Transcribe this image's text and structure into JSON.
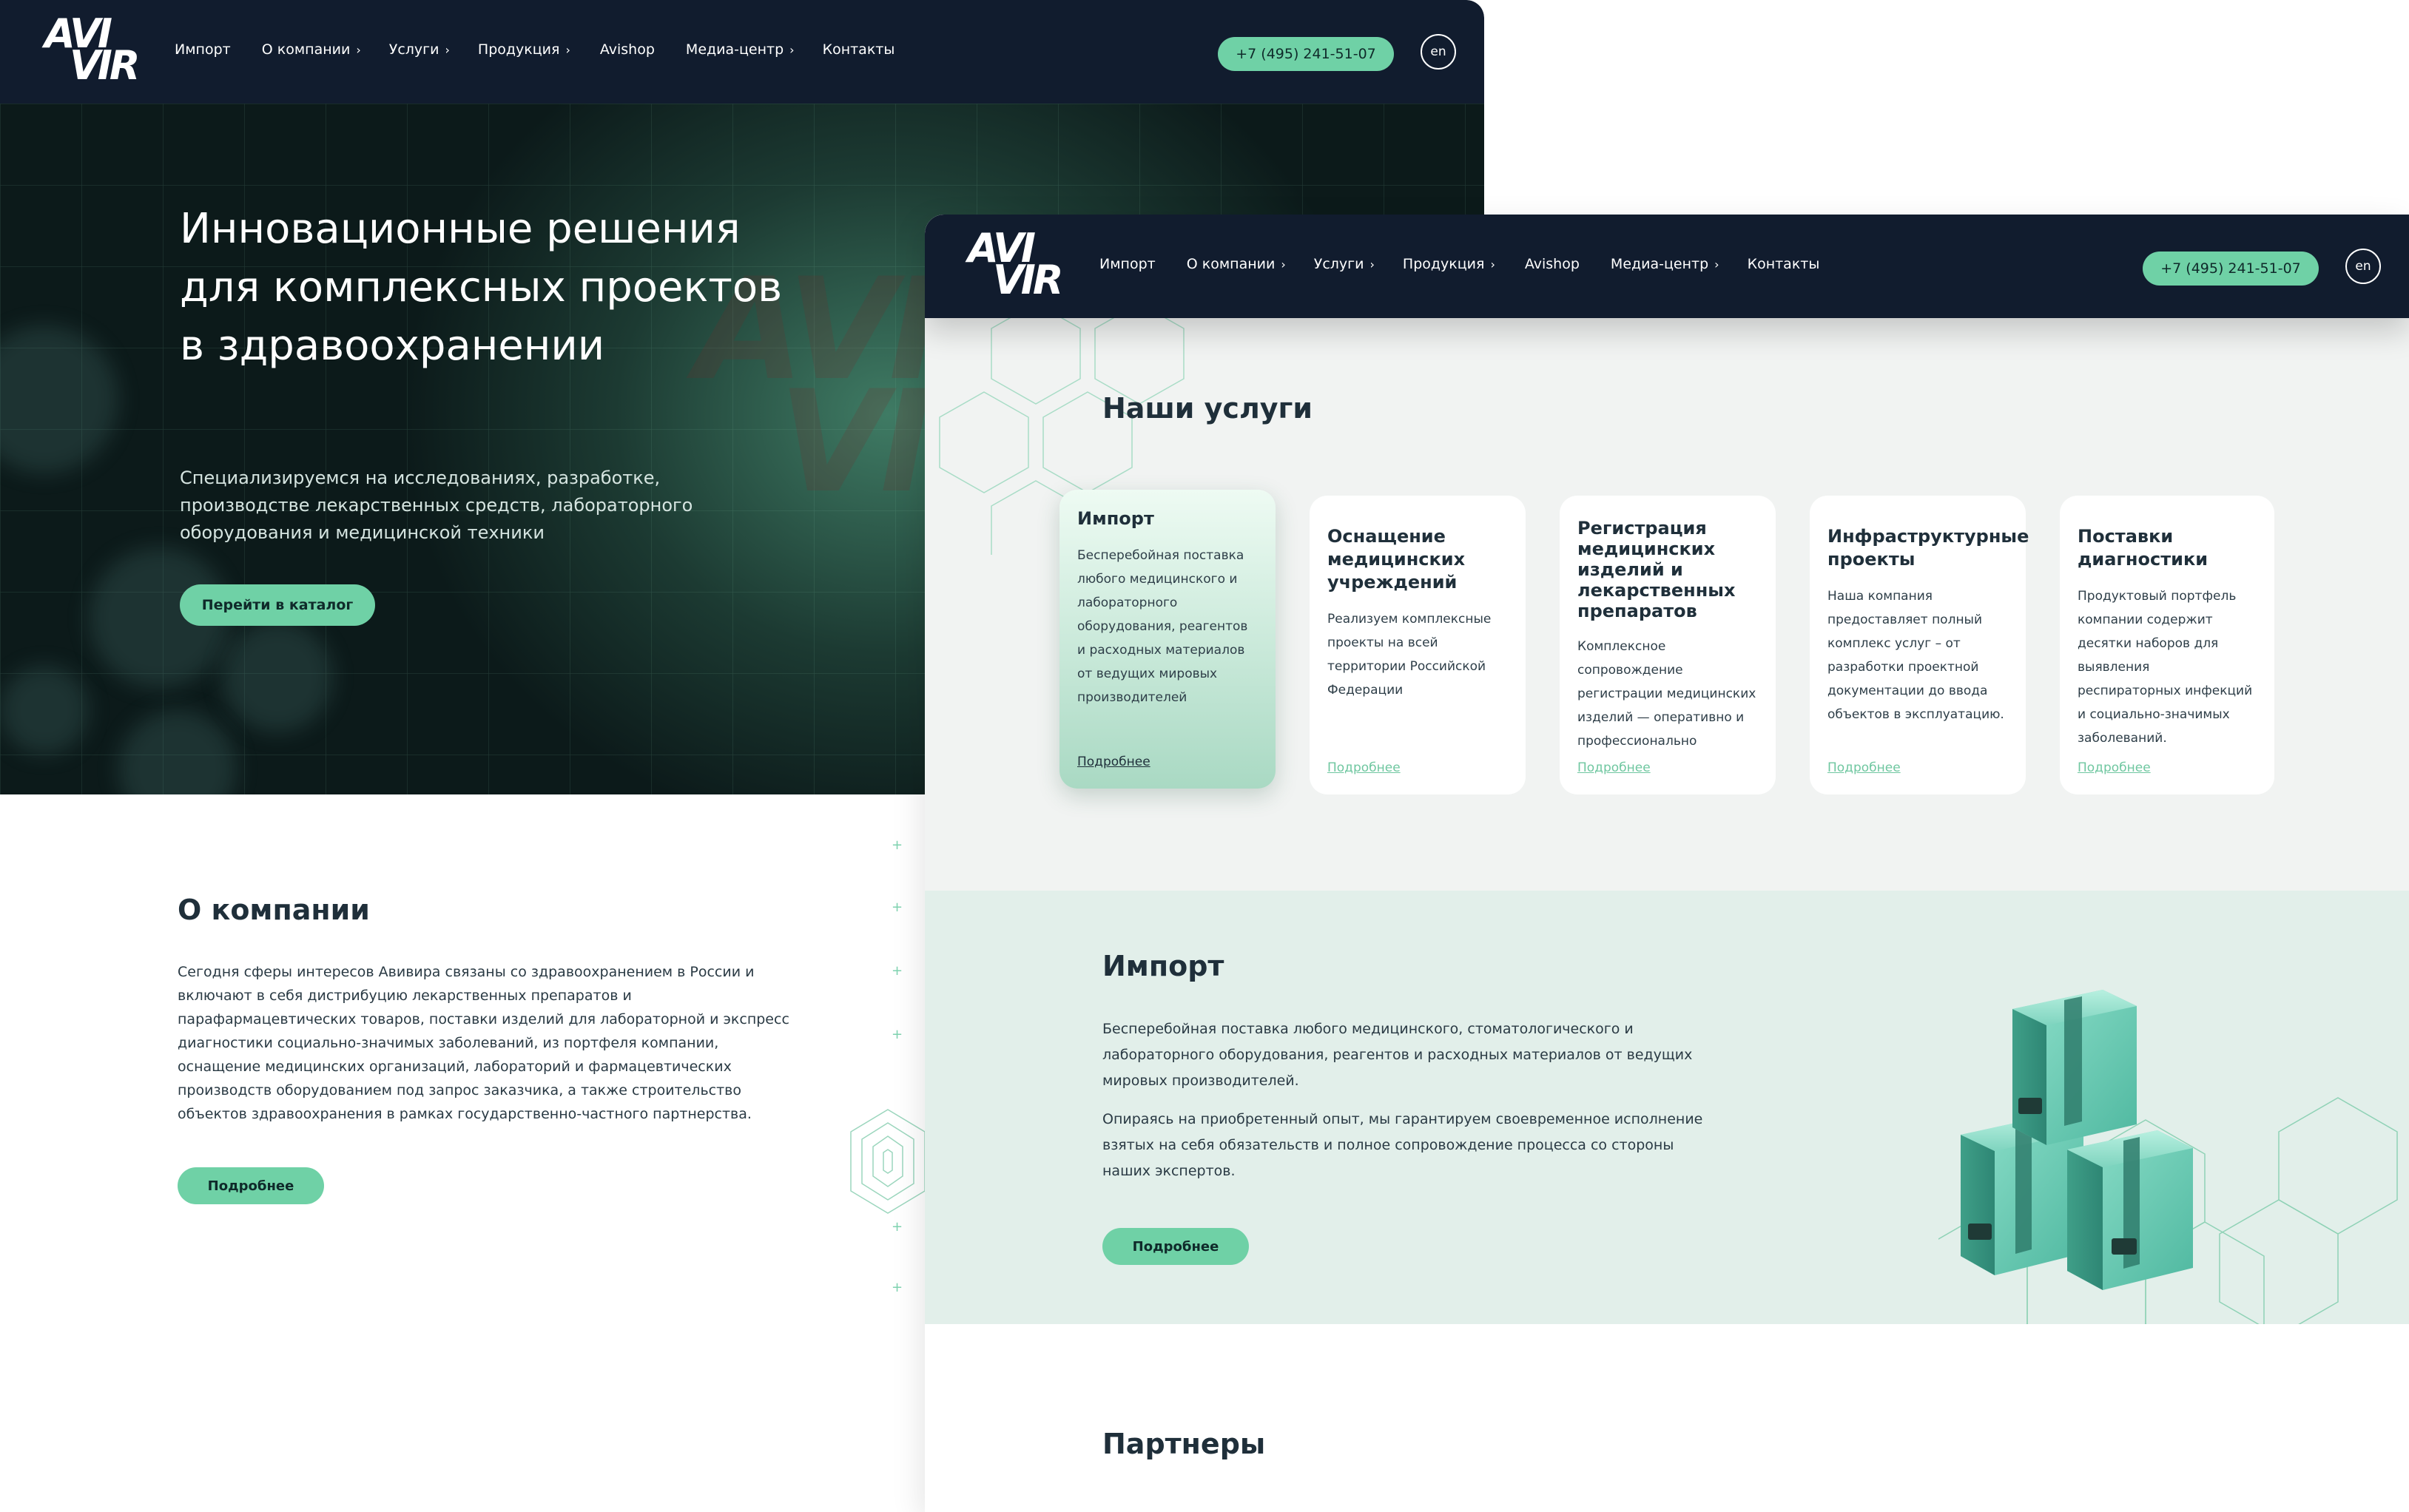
{
  "brand": {
    "logo_line1": "AVI",
    "logo_line2": "VIR",
    "accent": "#6fd1a6",
    "header_bg": "#111c2e"
  },
  "nav": [
    {
      "label": "Импорт",
      "has_submenu": false
    },
    {
      "label": "О компании",
      "has_submenu": true
    },
    {
      "label": "Услуги",
      "has_submenu": true
    },
    {
      "label": "Продукция",
      "has_submenu": true
    },
    {
      "label": "Avishop",
      "has_submenu": false
    },
    {
      "label": "Медиа-центр",
      "has_submenu": true
    },
    {
      "label": "Контакты",
      "has_submenu": false
    }
  ],
  "header": {
    "phone": "+7 (495) 241-51-07",
    "lang": "en",
    "chevron": "›"
  },
  "hero": {
    "title": "Инновационные решения для комплексных проектов в здравоохранении",
    "subtitle": "Специализируемся на исследованиях, разработке, производстве лекарственных средств, лабораторного оборудования и медицинской техники",
    "cta": "Перейти в каталог"
  },
  "about": {
    "title": "О компании",
    "text": "Сегодня сферы интересов Авивира связаны со здравоохранением в России и включают в себя дистрибуцию лекарственных препаратов и парафармацевтических товаров, поставки изделий для лабораторной и экспресс диагностики социально-значимых заболеваний, из портфеля компании, оснащение медицинских организаций, лабораторий и фармацевтических производств оборудованием под запрос заказчика, а также строительство объектов здравоохранения в рамках государственно-частного партнерства.",
    "button": "Подробнее"
  },
  "services": {
    "title": "Наши услуги",
    "cards": [
      {
        "title": "Импорт",
        "text": "Бесперебойная поставка любого медицинского и лабораторного оборудования, реагентов и расходных материалов от ведущих мировых производителей",
        "link": "Подробнее",
        "active": true
      },
      {
        "title": "Оснащение медицинских учреждений",
        "text": "Реализуем комплексные проекты на всей территории Российской Федерации",
        "link": "Подробнее",
        "active": false
      },
      {
        "title": "Регистрация медицинских изделий и лекарственных препаратов",
        "text": "Комплексное сопровождение регистрации медицинских изделий — оперативно и профессионально",
        "link": "Подробнее",
        "active": false
      },
      {
        "title": "Инфраструктурные проекты",
        "text": "Наша компания предоставляет полный комплекс услуг – от разработки проектной документации до ввода объектов в эксплуатацию.",
        "link": "Подробнее",
        "active": false
      },
      {
        "title": "Поставки диагностики",
        "text": "Продуктовый портфель компании содержит десятки наборов для выявления респираторных инфекций и социально-значимых заболеваний.",
        "link": "Подробнее",
        "active": false
      }
    ]
  },
  "import": {
    "title": "Импорт",
    "p1": "Бесперебойная поставка любого медицинского, стоматологического и лабораторного оборудования, реагентов и расходных материалов от ведущих мировых производителей.",
    "p2": "Опираясь на приобретенный опыт, мы гарантируем своевременное исполнение взятых на себя обязательств и полное сопровождение процесса со стороны наших экспертов.",
    "button": "Подробнее"
  },
  "partners": {
    "title": "Партнеры"
  }
}
